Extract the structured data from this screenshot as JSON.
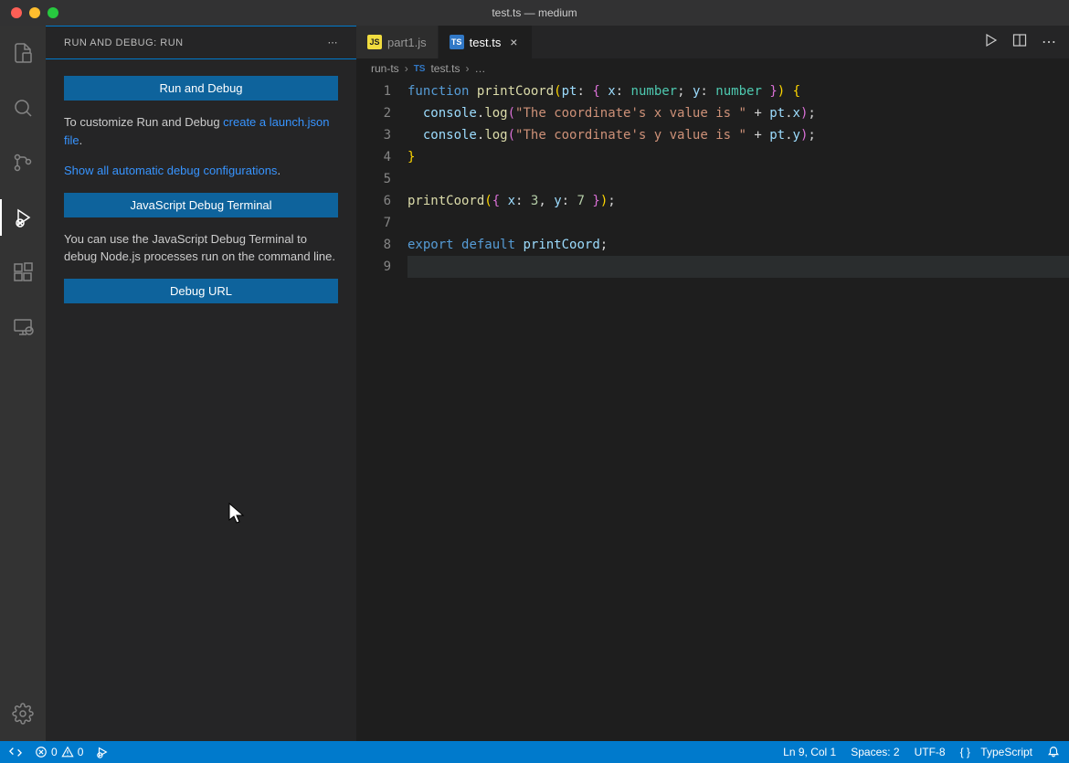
{
  "titlebar": {
    "title": "test.ts — medium"
  },
  "sidebar": {
    "header": "RUN AND DEBUG: RUN",
    "run_debug_btn": "Run and Debug",
    "customize_text_prefix": "To customize Run and Debug ",
    "create_launch_link": "create a launch.json file",
    "period": ".",
    "show_auto_link": "Show all automatic debug configurations",
    "js_terminal_btn": "JavaScript Debug Terminal",
    "js_terminal_desc": "You can use the JavaScript Debug Terminal to debug Node.js processes run on the command line.",
    "debug_url_btn": "Debug URL"
  },
  "tabs": [
    {
      "icon": "JS",
      "label": "part1.js",
      "active": false,
      "close": false
    },
    {
      "icon": "TS",
      "label": "test.ts",
      "active": true,
      "close": true
    }
  ],
  "breadcrumbs": {
    "seg0": "run-ts",
    "seg1": "test.ts",
    "seg2": "…"
  },
  "code": {
    "lines": [
      1,
      2,
      3,
      4,
      5,
      6,
      7,
      8,
      9
    ],
    "l1": {
      "kw1": "function",
      "fn": "printCoord",
      "p": "pt",
      "kw2": "x",
      "t1": "number",
      "kw3": "y",
      "t2": "number"
    },
    "l2": {
      "obj": "console",
      "m": "log",
      "s": "\"The coordinate's x value is \"",
      "v": "pt",
      "f": "x"
    },
    "l3": {
      "obj": "console",
      "m": "log",
      "s": "\"The coordinate's y value is \"",
      "v": "pt",
      "f": "y"
    },
    "l6": {
      "fn": "printCoord",
      "k1": "x",
      "n1": "3",
      "k2": "y",
      "n2": "7"
    },
    "l8": {
      "kw1": "export",
      "kw2": "default",
      "id": "printCoord"
    }
  },
  "statusbar": {
    "errors": "0",
    "warnings": "0",
    "ln_col": "Ln 9, Col 1",
    "spaces": "Spaces: 2",
    "encoding": "UTF-8",
    "lang": "TypeScript"
  }
}
